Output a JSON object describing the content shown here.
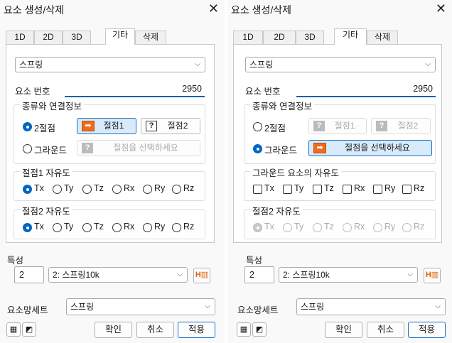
{
  "left": {
    "title": "요소 생성/삭제",
    "tabs": [
      "1D",
      "2D",
      "3D",
      "기타",
      "삭제"
    ],
    "type_combo": "스프링",
    "elem_no_label": "요소 번호",
    "elem_no": "2950",
    "group_conn": "종류와 연결정보",
    "opt_2node": "2절점",
    "opt_ground": "그라운드",
    "node1_btn": "절점1",
    "node2_btn": "절점2",
    "select_node_btn": "절점을 선택하세요",
    "group_dof1": "절점1 자유도",
    "group_dof2": "절점2 자유도",
    "dofs": [
      "Tx",
      "Ty",
      "Tz",
      "Rx",
      "Ry",
      "Rz"
    ],
    "prop_label": "특성",
    "prop_no": "2",
    "prop_combo": "2: 스프링10k",
    "mesh_label": "요소망세트",
    "mesh_combo": "스프링",
    "ok": "확인",
    "cancel": "취소",
    "apply": "적용"
  },
  "right": {
    "title": "요소 생성/삭제",
    "tabs": [
      "1D",
      "2D",
      "3D",
      "기타",
      "삭제"
    ],
    "type_combo": "스프링",
    "elem_no_label": "요소 번호",
    "elem_no": "2950",
    "group_conn": "종류와 연결정보",
    "opt_2node": "2절점",
    "opt_ground": "그라운드",
    "node1_btn": "절점1",
    "node2_btn": "절점2",
    "select_node_btn": "절점을 선택하세요",
    "group_dof1": "그라운드 요소의 자유도",
    "group_dof2": "절점2 자유도",
    "dofs": [
      "Tx",
      "Ty",
      "Tz",
      "Rx",
      "Ry",
      "Rz"
    ],
    "prop_label": "특성",
    "prop_no": "2",
    "prop_combo": "2: 스프링10k",
    "mesh_label": "요소망세트",
    "mesh_combo": "스프링",
    "ok": "확인",
    "cancel": "취소",
    "apply": "적용"
  },
  "colors": {
    "accent": "#0067c0",
    "highlight": "#d9ebfa",
    "orange_icon": "#ef6c1a"
  }
}
